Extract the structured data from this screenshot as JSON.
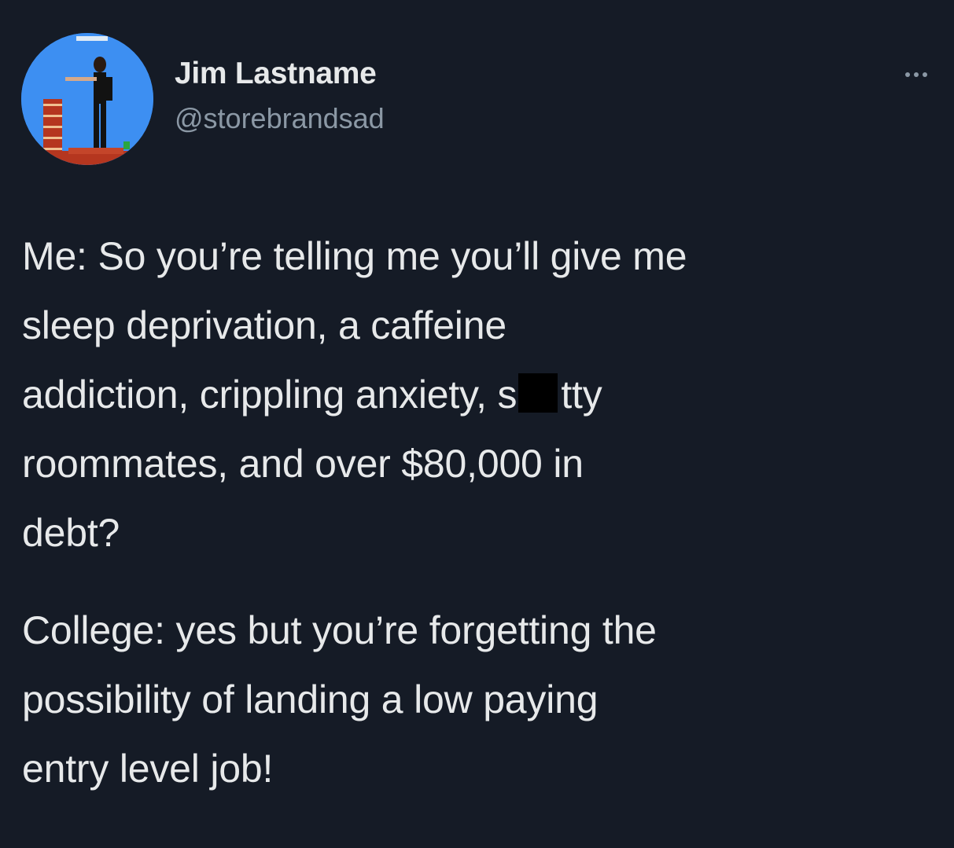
{
  "author": {
    "display_name": "Jim Lastname",
    "handle": "@storebrandsad",
    "avatar_icon": "profile-photo-icon"
  },
  "more_icon": "more-options-icon",
  "tweet": {
    "para1_lines": [
      "Me: So you’re telling me you’ll give me",
      "sleep deprivation, a caffeine",
      "addiction, crippling anxiety, s",
      "tty",
      "roommates, and over $80,000 in",
      "debt?"
    ],
    "para2_lines": [
      "College: yes but you’re forgetting the",
      "possibility of landing a low paying",
      "entry level job!"
    ]
  },
  "colors": {
    "background": "#151b26",
    "text": "#e7e9ea",
    "secondary_text": "#8b98a5",
    "redaction": "#000000"
  }
}
